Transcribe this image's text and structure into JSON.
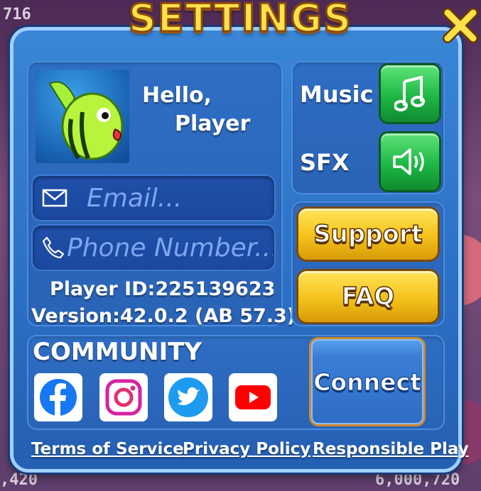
{
  "window": {
    "title": "SETTINGS"
  },
  "background": {
    "top_left_number": "716",
    "bottom_left_number": ",420",
    "bottom_right_number": "6,000,720"
  },
  "profile": {
    "greeting_line1": "Hello,",
    "greeting_line2": "Player"
  },
  "fields": {
    "email_placeholder": "Email...",
    "phone_placeholder": "Phone Number..."
  },
  "info": {
    "player_id": "Player ID:225139623",
    "version": "Version:42.0.2  (AB 57.3)"
  },
  "audio": {
    "music_label": "Music",
    "sfx_label": "SFX",
    "music_icon": "music-note-icon",
    "sfx_icon": "speaker-icon"
  },
  "buttons": {
    "support": "Support",
    "faq": "FAQ",
    "connect": "Connect"
  },
  "community": {
    "title": "COMMUNITY",
    "icons": [
      "facebook-icon",
      "instagram-icon",
      "twitter-icon",
      "youtube-icon"
    ]
  },
  "footer": {
    "terms": "Terms of Service",
    "privacy": "Privacy Policy",
    "responsible": "Responsible Play"
  },
  "colors": {
    "panel": "#2b6fc4",
    "accent_yellow": "#f4c21a",
    "accent_green": "#1eb845",
    "title_yellow": "#ffe14a"
  }
}
